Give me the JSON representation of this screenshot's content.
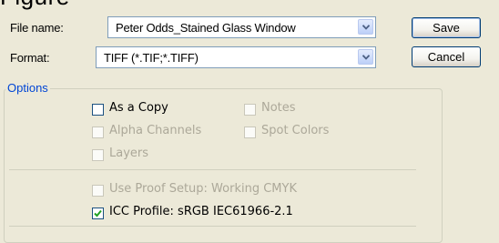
{
  "fragment": "Figure",
  "file_name": {
    "label": "File name:",
    "value": "Peter Odds_Stained Glass Window"
  },
  "format": {
    "label": "Format:",
    "value": "TIFF (*.TIF;*.TIFF)"
  },
  "buttons": {
    "save": "Save",
    "cancel": "Cancel"
  },
  "options": {
    "title": "Options",
    "as_a_copy": {
      "label": "As a Copy",
      "checked": false,
      "enabled": true
    },
    "notes": {
      "label": "Notes",
      "checked": false,
      "enabled": false
    },
    "alpha_channels": {
      "label": "Alpha Channels",
      "checked": false,
      "enabled": false
    },
    "spot_colors": {
      "label": "Spot Colors",
      "checked": false,
      "enabled": false
    },
    "layers": {
      "label": "Layers",
      "checked": false,
      "enabled": false
    }
  },
  "color": {
    "use_proof_setup": {
      "label": "Use Proof Setup:  Working CMYK",
      "checked": false,
      "enabled": false
    },
    "icc_profile": {
      "label": "ICC Profile:  sRGB IEC61966-2.1",
      "checked": true,
      "enabled": true
    }
  },
  "colors": {
    "accent": "#0046d5",
    "disabled_text": "#aca899",
    "background": "#ece9d8"
  }
}
